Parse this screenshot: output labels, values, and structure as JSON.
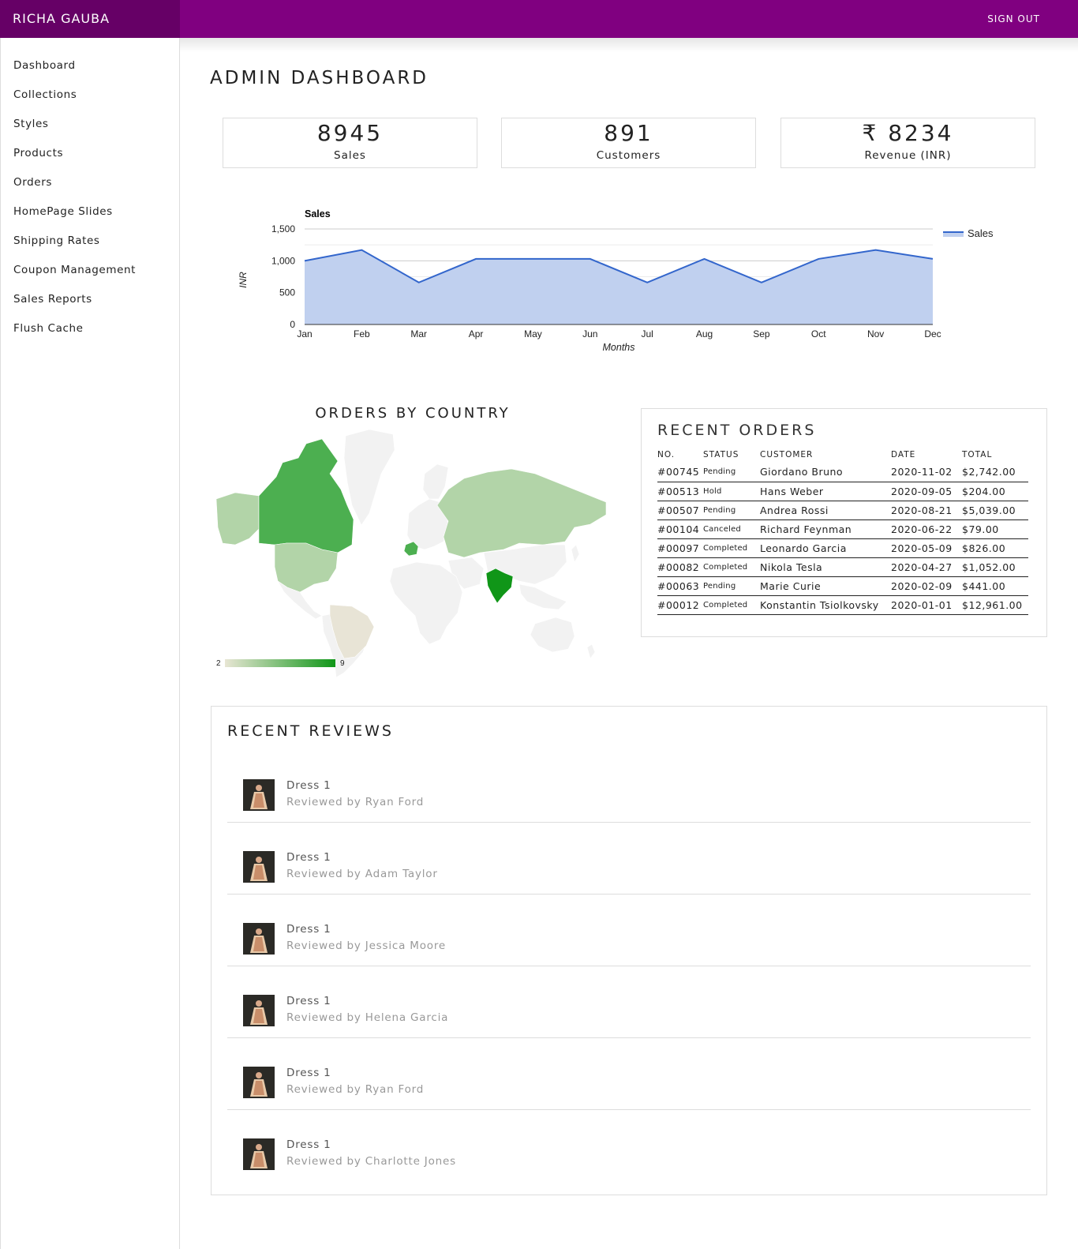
{
  "header": {
    "brand": "RICHA GAUBA",
    "sign_out": "SIGN OUT",
    "bar_color": "#800080",
    "brand_color": "#660066"
  },
  "sidebar": {
    "items": [
      {
        "label": "Dashboard"
      },
      {
        "label": "Collections"
      },
      {
        "label": "Styles"
      },
      {
        "label": "Products"
      },
      {
        "label": "Orders"
      },
      {
        "label": "HomePage Slides"
      },
      {
        "label": "Shipping Rates"
      },
      {
        "label": "Coupon Management"
      },
      {
        "label": "Sales Reports"
      },
      {
        "label": "Flush Cache"
      }
    ]
  },
  "page": {
    "title": "ADMIN DASHBOARD"
  },
  "stats": [
    {
      "value": "8945",
      "label": "Sales"
    },
    {
      "value": "891",
      "label": "Customers"
    },
    {
      "value": "₹ 8234",
      "label": "Revenue (INR)"
    }
  ],
  "chart_data": {
    "type": "area",
    "title": "Sales",
    "xlabel": "Months",
    "ylabel": "INR",
    "categories": [
      "Jan",
      "Feb",
      "Mar",
      "Apr",
      "May",
      "Jun",
      "Jul",
      "Aug",
      "Sep",
      "Oct",
      "Nov",
      "Dec"
    ],
    "series": [
      {
        "name": "Sales",
        "values": [
          1000,
          1170,
          660,
          1030,
          1030,
          1030,
          660,
          1030,
          660,
          1030,
          1170,
          1030
        ]
      }
    ],
    "ylim": [
      0,
      1500
    ],
    "yticks": [
      "0",
      "500",
      "1,000",
      "1,500"
    ],
    "grid": true,
    "legend": "right",
    "line_color": "#3366cc",
    "fill_color": "#c0d0ef"
  },
  "map": {
    "title": "ORDERS BY COUNTRY",
    "legend_min": "2",
    "legend_max": "9",
    "colors": {
      "low": "#e8e6d4",
      "high": "#109618",
      "none": "#f2f2f2"
    }
  },
  "recent_orders": {
    "title": "RECENT ORDERS",
    "columns": [
      "NO.",
      "STATUS",
      "CUSTOMER",
      "DATE",
      "TOTAL"
    ],
    "rows": [
      {
        "no": "#00745",
        "status": "Pending",
        "customer": "Giordano Bruno",
        "date": "2020-11-02",
        "total": "$2,742.00"
      },
      {
        "no": "#00513",
        "status": "Hold",
        "customer": "Hans Weber",
        "date": "2020-09-05",
        "total": "$204.00"
      },
      {
        "no": "#00507",
        "status": "Pending",
        "customer": "Andrea Rossi",
        "date": "2020-08-21",
        "total": "$5,039.00"
      },
      {
        "no": "#00104",
        "status": "Canceled",
        "customer": "Richard Feynman",
        "date": "2020-06-22",
        "total": "$79.00"
      },
      {
        "no": "#00097",
        "status": "Completed",
        "customer": "Leonardo Garcia",
        "date": "2020-05-09",
        "total": "$826.00"
      },
      {
        "no": "#00082",
        "status": "Completed",
        "customer": "Nikola Tesla",
        "date": "2020-04-27",
        "total": "$1,052.00"
      },
      {
        "no": "#00063",
        "status": "Pending",
        "customer": "Marie Curie",
        "date": "2020-02-09",
        "total": "$441.00"
      },
      {
        "no": "#00012",
        "status": "Completed",
        "customer": "Konstantin Tsiolkovsky",
        "date": "2020-01-01",
        "total": "$12,961.00"
      }
    ]
  },
  "recent_reviews": {
    "title": "RECENT REVIEWS",
    "items": [
      {
        "product": "Dress 1",
        "by": "Reviewed by Ryan Ford"
      },
      {
        "product": "Dress 1",
        "by": "Reviewed by Adam Taylor"
      },
      {
        "product": "Dress 1",
        "by": "Reviewed by Jessica Moore"
      },
      {
        "product": "Dress 1",
        "by": "Reviewed by Helena Garcia"
      },
      {
        "product": "Dress 1",
        "by": "Reviewed by Ryan Ford"
      },
      {
        "product": "Dress 1",
        "by": "Reviewed by Charlotte Jones"
      }
    ]
  }
}
